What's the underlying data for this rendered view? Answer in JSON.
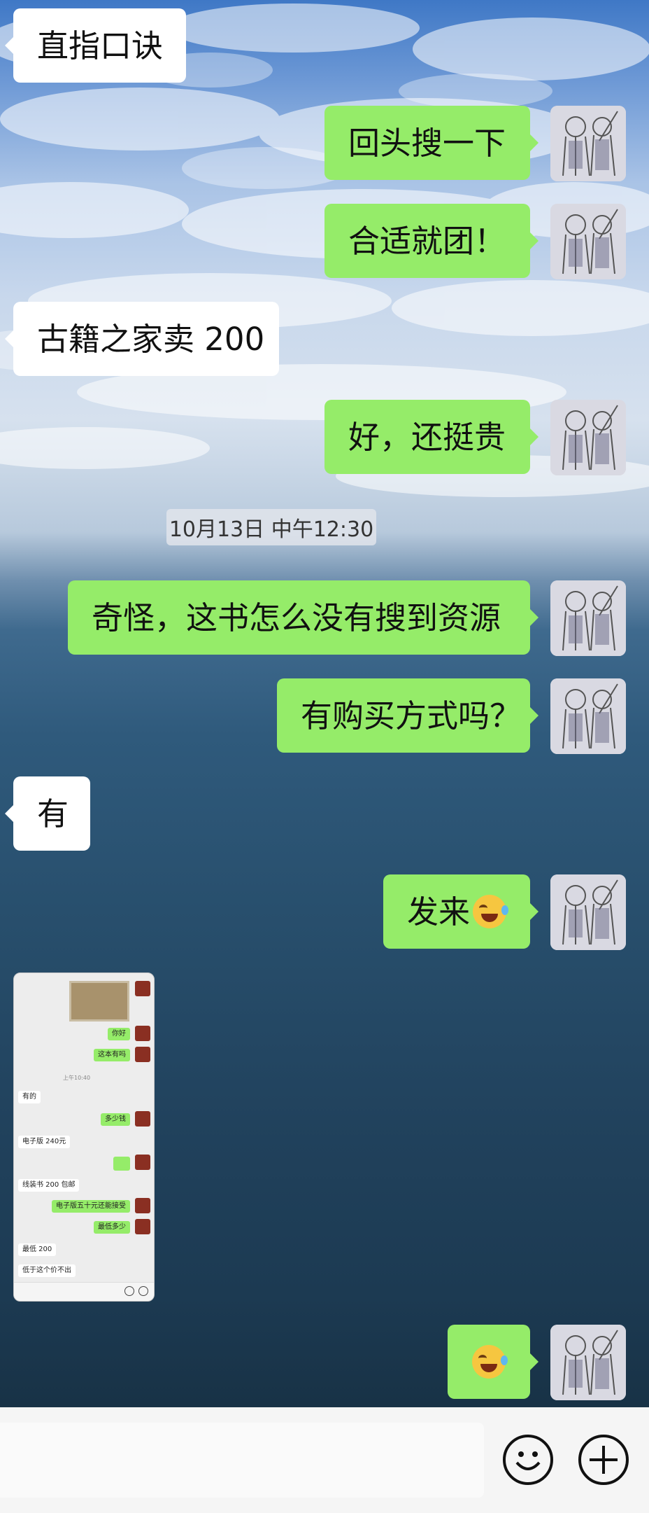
{
  "chat": {
    "messages": [
      {
        "dir": "in",
        "text": "直指口诀"
      },
      {
        "dir": "out",
        "text": "回头搜一下"
      },
      {
        "dir": "out",
        "text": "合适就团！"
      },
      {
        "dir": "in",
        "text": "古籍之家卖 200"
      },
      {
        "dir": "out",
        "text": "好，还挺贵"
      },
      {
        "dir": "out",
        "text": "奇怪，这书怎么没有搜到资源"
      },
      {
        "dir": "out",
        "text": "有购买方式吗？"
      },
      {
        "dir": "in",
        "text": "有"
      },
      {
        "dir": "out",
        "text": "发来",
        "emoji": "facepalm-laugh-emoji"
      },
      {
        "dir": "out",
        "text": "",
        "emoji": "facepalm-laugh-emoji"
      }
    ],
    "timestamp": "10月13日 中午12:30"
  },
  "image_message": {
    "items": [
      {
        "dir": "out",
        "text": "你好"
      },
      {
        "dir": "out",
        "text": "这本有吗"
      },
      {
        "dir": "ts",
        "text": "上午10:40"
      },
      {
        "dir": "in",
        "text": "有的"
      },
      {
        "dir": "out",
        "text": "多少钱"
      },
      {
        "dir": "in",
        "text": "电子版 240元"
      },
      {
        "dir": "out",
        "text": "",
        "emoji": "facepalm-laugh-emoji"
      },
      {
        "dir": "in",
        "text": "线装书 200 包邮"
      },
      {
        "dir": "out",
        "text": "电子版五十元还能接受"
      },
      {
        "dir": "out",
        "text": "最低多少"
      },
      {
        "dir": "in",
        "text": "最低 200"
      },
      {
        "dir": "in",
        "text": "低于这个价不出"
      }
    ]
  },
  "input_bar": {
    "text_value": "",
    "emoji_icon": "smiley-icon",
    "plus_icon": "plus-icon"
  },
  "colors": {
    "bubble_out": "#95ec69",
    "bubble_in": "#ffffff",
    "input_bar_bg": "#f5f5f5"
  }
}
